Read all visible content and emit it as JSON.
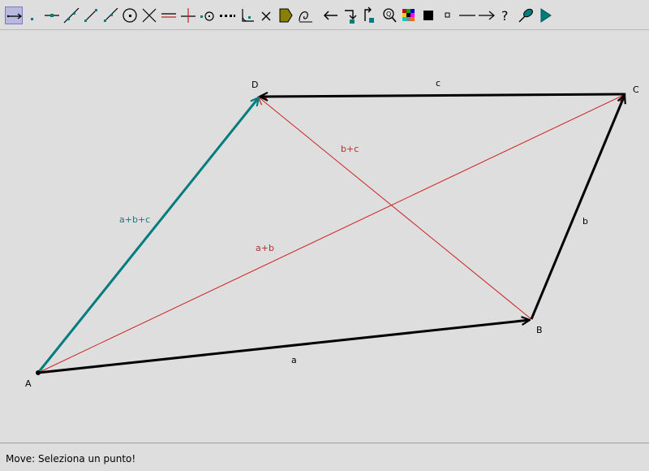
{
  "toolbar": {
    "tools": [
      {
        "name": "vector-tool",
        "icon": "vector-arrow-icon",
        "active": true
      },
      {
        "name": "point-tool",
        "icon": "point-icon"
      },
      {
        "name": "point-on-line-tool",
        "icon": "point-on-line-icon"
      },
      {
        "name": "line-tool",
        "icon": "line-icon"
      },
      {
        "name": "segment-tool",
        "icon": "segment-icon"
      },
      {
        "name": "ray-tool",
        "icon": "ray-icon"
      },
      {
        "name": "circle-tool",
        "icon": "circle-icon"
      },
      {
        "name": "intersection-tool",
        "icon": "intersection-icon"
      },
      {
        "name": "parallel-tool",
        "icon": "parallel-icon"
      },
      {
        "name": "perpendicular-tool",
        "icon": "perpendicular-icon"
      },
      {
        "name": "midpoint-tool",
        "icon": "midpoint-icon"
      },
      {
        "name": "dotted-line-tool",
        "icon": "dotted-line-icon"
      },
      {
        "name": "angle-tool",
        "icon": "angle-icon"
      },
      {
        "name": "delete-tool",
        "icon": "delete-x-icon"
      },
      {
        "name": "fill-tool",
        "icon": "polygon-fill-icon"
      },
      {
        "name": "locus-tool",
        "icon": "locus-icon"
      },
      {
        "name": "undo-tool",
        "icon": "back-arrow-icon"
      },
      {
        "name": "redo-tool",
        "icon": "redo-icon"
      },
      {
        "name": "redo-all-tool",
        "icon": "redo-all-icon"
      },
      {
        "name": "zoom-tool",
        "icon": "zoom-icon"
      },
      {
        "name": "color-tool",
        "icon": "color-palette-icon"
      },
      {
        "name": "thick-point-tool",
        "icon": "big-square-icon"
      },
      {
        "name": "thin-point-tool",
        "icon": "small-square-icon"
      },
      {
        "name": "line-style-tool",
        "icon": "line-style-icon"
      },
      {
        "name": "arrow-style-tool",
        "icon": "arrow-style-icon"
      },
      {
        "name": "help-tool",
        "icon": "question-icon"
      },
      {
        "name": "pin-tool",
        "icon": "pin-icon"
      },
      {
        "name": "play-tool",
        "icon": "play-icon"
      }
    ]
  },
  "colors": {
    "black": "#000000",
    "red": "#cc2222",
    "teal": "#007c7c",
    "label_red": "#b03030",
    "label_teal": "#1a7a7a",
    "toolbar_active": "#b8b8e0",
    "background": "#dedede"
  },
  "figure": {
    "points": {
      "A": "A",
      "B": "B",
      "C": "C",
      "D": "D"
    },
    "vector_labels": {
      "a": "a",
      "b": "b",
      "c": "c",
      "a_plus_b": "a+b",
      "b_plus_c": "b+c",
      "a_plus_b_plus_c": "a+b+c"
    }
  },
  "status": {
    "text": "Move: Seleziona un punto!"
  }
}
